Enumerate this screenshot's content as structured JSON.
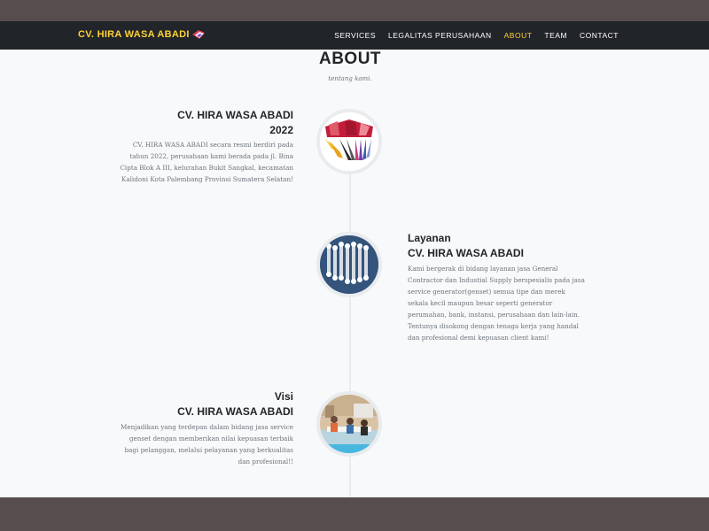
{
  "navbar": {
    "brand": "CV. HIRA WASA ABADI",
    "items": [
      {
        "label": "SERVICES"
      },
      {
        "label": "LEGALITAS PERUSAHAAN"
      },
      {
        "label": "ABOUT",
        "active": true
      },
      {
        "label": "TEAM"
      },
      {
        "label": "CONTACT"
      }
    ],
    "colors": {
      "bg": "#212529",
      "accent": "#fed136"
    }
  },
  "about": {
    "title": "ABOUT",
    "subtitle": "tentang kami.",
    "items": [
      {
        "title_line1": "CV. HIRA WASA ABADI",
        "title_line2": "2022",
        "text_lines": [
          "CV. HIRA WASA ABADI secara resmi berdiri pada",
          "tahun 2022, perusahaan kami berada pada jl. Bina",
          "Cipta Blok A III, kelurahan Bukit Sangkal, kecamatan",
          "Kalidoni Kota Palembang Provinsi Sumatera Selatan!"
        ],
        "icon": "color-swatch-image"
      },
      {
        "title_line1": "Layanan",
        "title_line2": "CV. HIRA WASA ABADI",
        "text_lines": [
          "Kami bergerak di bidang layanan jasa General",
          "Contractor dan Industial Supply berspesialis pada jasa",
          "service generator(genset) semua tipe dan merek",
          "sekala kecil maupun besar seperti generator",
          "perumahan, bank, instansi, perusahaan dan lain-lain.",
          "Tentunya disokong dengan tenaga kerja yang handal",
          "dan profesional demi kepuasan client kami!"
        ],
        "icon": "wrenches-image"
      },
      {
        "title_line1": "Visi",
        "title_line2": "CV. HIRA WASA ABADI",
        "text_lines": [
          "Menjadikan yang terdepan dalam bidang jasa service",
          "genset dengan memberikan nilai kepuasan terbaik",
          "bagi pelanggan, melalui pelayanan yang berkualitas",
          "dan profesional!!"
        ],
        "icon": "team-meeting-image"
      }
    ]
  }
}
